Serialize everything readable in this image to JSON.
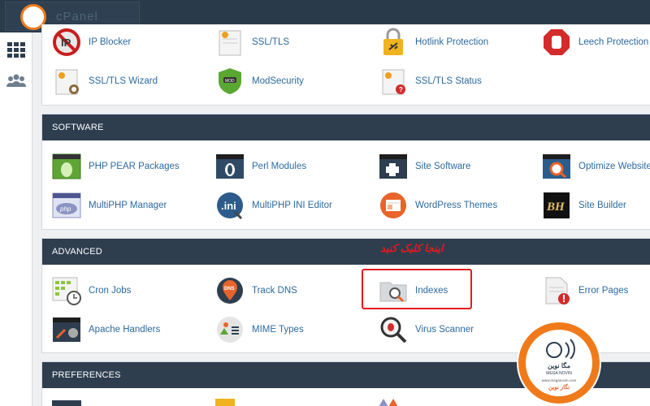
{
  "logo": {
    "text": "cPanel"
  },
  "sidebar": {
    "items": [
      {
        "icon": "grid-icon"
      },
      {
        "icon": "users-icon"
      }
    ]
  },
  "sections": {
    "security": {
      "items": [
        {
          "label": "IP Blocker",
          "icon": "ip-blocker-icon"
        },
        {
          "label": "SSL/TLS",
          "icon": "ssl-tls-icon"
        },
        {
          "label": "Hotlink Protection",
          "icon": "hotlink-protection-icon"
        },
        {
          "label": "Leech Protection",
          "icon": "leech-protection-icon"
        },
        {
          "label": "SSL/TLS Wizard",
          "icon": "ssl-wizard-icon"
        },
        {
          "label": "ModSecurity",
          "icon": "modsecurity-icon"
        },
        {
          "label": "SSL/TLS Status",
          "icon": "ssl-status-icon"
        }
      ]
    },
    "software": {
      "title": "SOFTWARE",
      "items": [
        {
          "label": "PHP PEAR Packages",
          "icon": "php-pear-icon"
        },
        {
          "label": "Perl Modules",
          "icon": "perl-modules-icon"
        },
        {
          "label": "Site Software",
          "icon": "site-software-icon"
        },
        {
          "label": "Optimize Website",
          "icon": "optimize-website-icon"
        },
        {
          "label": "MultiPHP Manager",
          "icon": "multiphp-manager-icon"
        },
        {
          "label": "MultiPHP INI Editor",
          "icon": "multiphp-ini-icon"
        },
        {
          "label": "WordPress Themes",
          "icon": "wordpress-themes-icon"
        },
        {
          "label": "Site Builder",
          "icon": "site-builder-icon"
        }
      ]
    },
    "advanced": {
      "title": "ADVANCED",
      "items": [
        {
          "label": "Cron Jobs",
          "icon": "cron-jobs-icon"
        },
        {
          "label": "Track DNS",
          "icon": "track-dns-icon"
        },
        {
          "label": "Indexes",
          "icon": "indexes-icon"
        },
        {
          "label": "Error Pages",
          "icon": "error-pages-icon"
        },
        {
          "label": "Apache Handlers",
          "icon": "apache-handlers-icon"
        },
        {
          "label": "MIME Types",
          "icon": "mime-types-icon"
        },
        {
          "label": "Virus Scanner",
          "icon": "virus-scanner-icon"
        }
      ]
    },
    "preferences": {
      "title": "PREFERENCES"
    }
  },
  "annotation": {
    "text": "اینجا کلیک کنید"
  },
  "watermark": {
    "text": "مگا نوین",
    "subtext": "MEGA NOVIN",
    "url": "www.meganovin.com",
    "footer": "نگار نوین"
  },
  "colors": {
    "topbar": "#293a4a",
    "header": "#2e3e4f",
    "link": "#2c6aa0",
    "highlight": "#e21b1b",
    "brand": "#f07a1a"
  }
}
